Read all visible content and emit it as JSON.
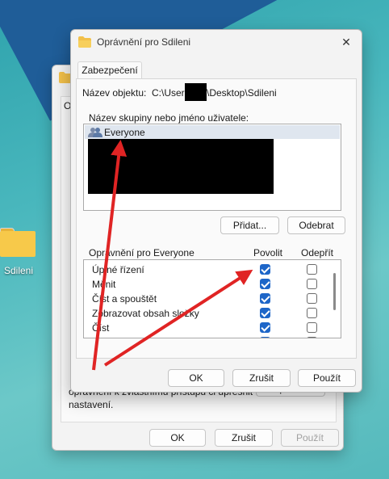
{
  "desktop": {
    "folder_label": "Sdileni"
  },
  "back_window": {
    "tab_letter": "O",
    "text": "oprávnění k zvláštnímu přístupu či upřesnit nastavení.",
    "advanced_label": "Upřesnit",
    "ok_label": "OK",
    "cancel_label": "Zrušit",
    "apply_label": "Použít"
  },
  "window": {
    "title": "Oprávnění pro Sdileni",
    "tab_label": "Zabezpečení",
    "object_name_label": "Název objektu:",
    "object_path_prefix": "C:\\Users",
    "object_path_suffix": "\\Desktop\\Sdileni",
    "group_label": "Název skupiny nebo jméno uživatele:",
    "groups": [
      {
        "name": "Everyone",
        "selected": true
      }
    ],
    "add_label": "Přidat...",
    "remove_label": "Odebrat",
    "permissions_label": "Oprávnění pro Everyone",
    "allow_header": "Povolit",
    "deny_header": "Odepřít",
    "permissions": [
      {
        "name": "Úplné řízení",
        "allow": true,
        "deny": false
      },
      {
        "name": "Měnit",
        "allow": true,
        "deny": false
      },
      {
        "name": "Číst a spouštět",
        "allow": true,
        "deny": false
      },
      {
        "name": "Zobrazovat obsah složky",
        "allow": true,
        "deny": false
      },
      {
        "name": "Číst",
        "allow": true,
        "deny": false
      },
      {
        "name": "",
        "allow": true,
        "deny": false
      }
    ],
    "ok_label": "OK",
    "cancel_label": "Zrušit",
    "apply_label": "Použít"
  },
  "colors": {
    "accent": "#1e66c8",
    "annotation_arrow": "#e02424"
  }
}
